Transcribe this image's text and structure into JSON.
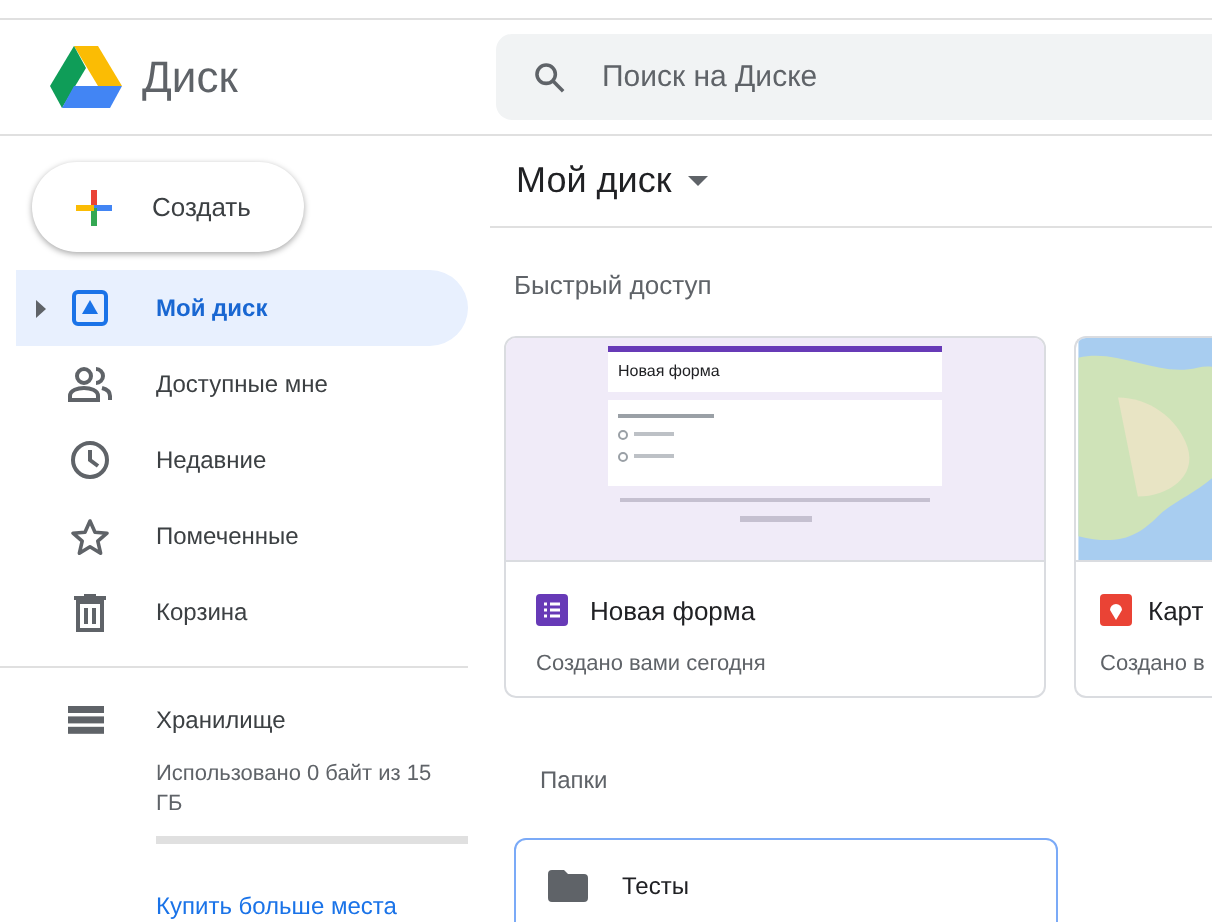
{
  "app": {
    "title": "Диск"
  },
  "search": {
    "placeholder": "Поиск на Диске"
  },
  "create_button": {
    "label": "Создать"
  },
  "sidebar": {
    "items": [
      {
        "kind": "drive",
        "label": "Мой диск",
        "selected": true
      },
      {
        "kind": "shared",
        "label": "Доступные мне",
        "selected": false
      },
      {
        "kind": "recent",
        "label": "Недавние",
        "selected": false
      },
      {
        "kind": "starred",
        "label": "Помеченные",
        "selected": false
      },
      {
        "kind": "trash",
        "label": "Корзина",
        "selected": false
      }
    ],
    "storage": {
      "label": "Хранилище",
      "usage": "Использовано 0 байт из 15 ГБ",
      "link": "Купить больше места"
    }
  },
  "main": {
    "title": "Мой диск",
    "quick_access": {
      "heading": "Быстрый доступ",
      "cards": [
        {
          "kind": "form",
          "name": "Новая форма",
          "subtitle": "Создано вами сегодня",
          "preview_title": "Новая форма"
        },
        {
          "kind": "map",
          "name": "Карт",
          "subtitle": "Создано в"
        }
      ]
    },
    "folders": {
      "heading": "Папки",
      "items": [
        {
          "name": "Тесты",
          "selected": true
        }
      ]
    }
  }
}
